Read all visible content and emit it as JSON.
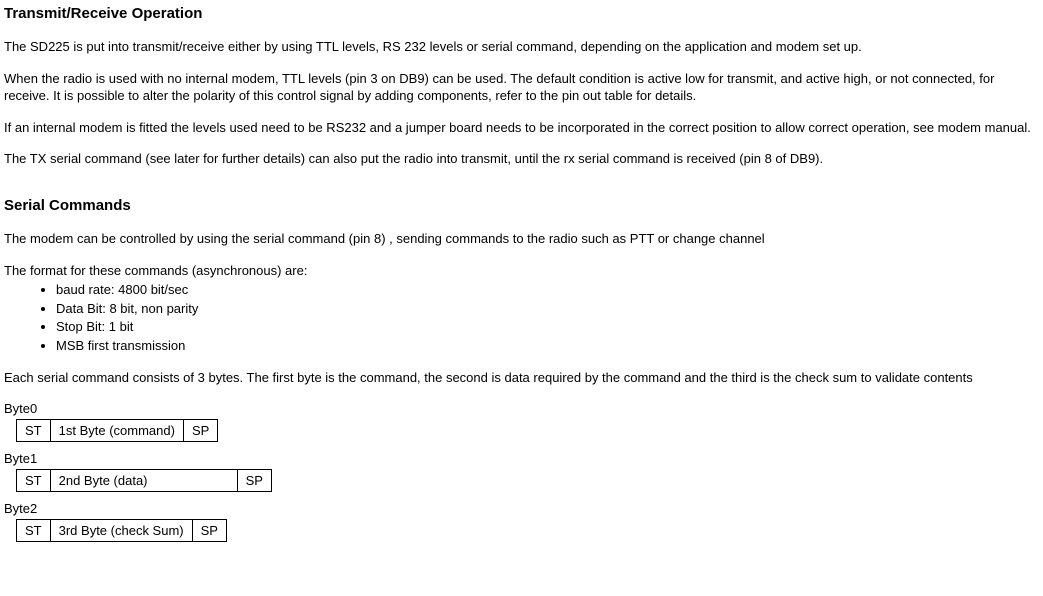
{
  "sections": {
    "tr": {
      "title": "Transmit/Receive Operation",
      "p1": "The SD225 is put into transmit/receive either by using TTL levels, RS 232 levels or serial command, depending on the application and modem set up.",
      "p2": "When the radio is used with no internal modem, TTL levels (pin 3 on DB9) can be used.  The default condition is active low for transmit, and active high, or not connected, for receive.  It is possible to alter the polarity of this control signal by adding components, refer to the pin out table for details.",
      "p3": "If an internal modem is fitted the levels used need to be RS232 and a jumper board needs to be incorporated in the correct position to allow correct operation, see modem manual.",
      "p4": "The TX serial command (see later for further details) can also put the radio into transmit, until the rx serial command is received (pin 8 of DB9)."
    },
    "sc": {
      "title": "Serial Commands",
      "p1": "The modem can be controlled by using the serial command (pin 8) , sending commands to the radio such as PTT or change channel",
      "formatLead": "The format for these commands (asynchronous) are:",
      "bullets": [
        "baud rate: 4800 bit/sec",
        "Data Bit: 8 bit, non parity",
        "Stop Bit: 1 bit",
        "MSB first transmission"
      ],
      "p2": "Each serial command consists of 3 bytes.  The first byte is the command, the second is data required by the command and the third is the check sum to validate contents"
    }
  },
  "bytes": [
    {
      "label": "Byte0",
      "c0": "ST",
      "c1": "1st Byte (command)",
      "c2": "SP",
      "wide": false
    },
    {
      "label": "Byte1",
      "c0": "ST",
      "c1": "2nd Byte (data)",
      "c2": "SP",
      "wide": true
    },
    {
      "label": "Byte2",
      "c0": "ST",
      "c1": "3rd Byte (check Sum)",
      "c2": "SP",
      "wide": false
    }
  ]
}
